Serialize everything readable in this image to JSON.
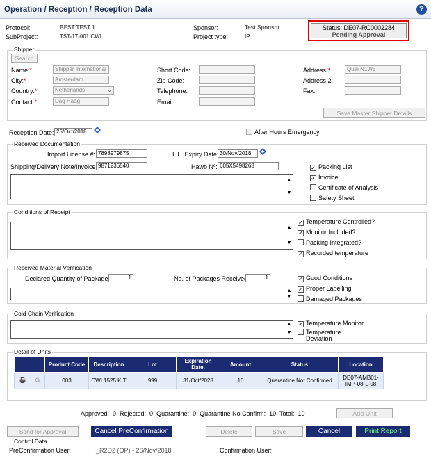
{
  "header": {
    "title": "Operation / Reception / Reception Data",
    "help_icon": "?"
  },
  "summary": {
    "protocol_label": "Protocol:",
    "protocol_value": "BEST TEST 1",
    "subproject_label": "SubProject:",
    "subproject_value": "TST-17-001 CWI",
    "sponsor_label": "Sponsor:",
    "sponsor_value": "Test Sponsor",
    "project_type_label": "Project type:",
    "project_type_value": "IP",
    "status_line1": "Status: DE07-RC0002284",
    "status_line2": "Pending Approval"
  },
  "shipper": {
    "legend": "Shipper",
    "search_label": "Search",
    "name_label": "Name:",
    "name_value": "Shipper International",
    "city_label": "City:",
    "city_value": "Amsterdam",
    "country_label": "Country:",
    "country_value": "Netherlands",
    "contact_label": "Contact:",
    "contact_value": "Dag Haag",
    "short_code_label": "Short Code:",
    "zip_label": "Zip Code:",
    "telephone_label": "Telephone:",
    "email_label": "Email:",
    "address_label": "Address:",
    "address_value": "Quai N1W5",
    "address2_label": "Address 2:",
    "fax_label": "Fax:",
    "save_master_label": "Save Master Shipper Details"
  },
  "reception": {
    "date_label": "Reception Date:",
    "date_value": "25/Oct/2018",
    "after_hours_label": "After Hours Emergency"
  },
  "documentation": {
    "legend": "Received Documentation",
    "import_license_label": "Import License #:",
    "import_license_value": "7898979875",
    "il_expiry_label": "I. L. Expiry Date:",
    "il_expiry_value": "30/Nov/2018",
    "shipping_note_label": "Shipping/Delivery Note/Invoice:",
    "shipping_note_value": "9871236540",
    "hawb_label": "Hawb Nº:",
    "hawb_value": "605X5498268",
    "checks": [
      {
        "label": "Packing List",
        "checked": true
      },
      {
        "label": "Invoice",
        "checked": true
      },
      {
        "label": "Certificate of Analysis",
        "checked": false
      },
      {
        "label": "Safety Sheet",
        "checked": false
      }
    ]
  },
  "conditions": {
    "legend": "Conditions of Receipt",
    "checks": [
      {
        "label": "Temperature Controlled?",
        "checked": true
      },
      {
        "label": "Monitor Included?",
        "checked": true
      },
      {
        "label": "Packing Integrated?",
        "checked": false
      },
      {
        "label": "Recorded temperature",
        "checked": true
      }
    ]
  },
  "material": {
    "legend": "Received Material Verification",
    "declared_label": "Declared Quantity of Packages:",
    "declared_value": "1",
    "received_label": "No. of Packages Received:",
    "received_value": "1",
    "checks": [
      {
        "label": "Good Conditions",
        "checked": true
      },
      {
        "label": "Proper Labelling",
        "checked": true
      },
      {
        "label": "Damaged Packages",
        "checked": false
      }
    ]
  },
  "coldchain": {
    "legend": "Cold Chain Verification",
    "checks": [
      {
        "label": "Temperature Monitor",
        "checked": true
      },
      {
        "label": "Temperature",
        "label2": "Deviation",
        "checked": false
      }
    ]
  },
  "units": {
    "legend": "Detail of Units",
    "headers": [
      "",
      "",
      "Product Code",
      "Description",
      "Lot",
      "Expiration Date.",
      "Amount",
      "Status",
      "Location"
    ],
    "rows": [
      {
        "product_code": "003",
        "description": "CWI 1525 KIT",
        "lot": "999",
        "expiration": "31/Oct/2028",
        "amount": "10",
        "status": "Quarantine Not Confirmed",
        "location_line1": "DE07-AMB01-",
        "location_line2": "IMP-08-L-08"
      }
    ]
  },
  "totals": {
    "text": "Approved:  0  Rejected:  0  Quarantine:  0  Quarantine No Confirm:  10  Total:  10",
    "add_unit_label": "Add Unit"
  },
  "actions": {
    "send_approval": "Send for Approval",
    "cancel_preconfirmation": "Cancel PreConfirmation",
    "delete": "Delete",
    "save": "Save",
    "cancel": "Cancel",
    "print_report": "Print Report"
  },
  "control": {
    "legend": "Control Data",
    "preconf_user_label": "PreConfirmation User:",
    "preconf_user_value": "_R2D2 (OP) - 26/Nov/2018",
    "conf_user_label": "Confirmation User:"
  },
  "colors": {
    "header_blue": "#1a2b72",
    "status_border": "#e00000",
    "print_text": "#7bff7b"
  }
}
